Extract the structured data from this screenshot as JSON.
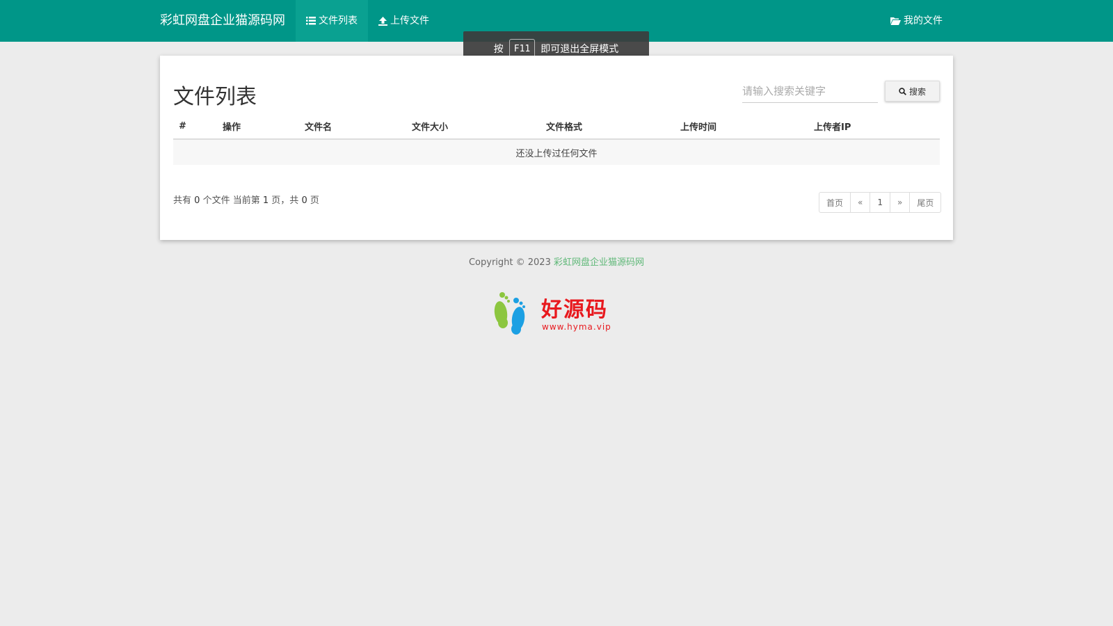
{
  "navbar": {
    "brand": "彩虹网盘企业猫源码网",
    "items": [
      {
        "label": "文件列表",
        "icon": "list-icon"
      },
      {
        "label": "上传文件",
        "icon": "upload-icon"
      }
    ],
    "right_item": {
      "label": "我的文件",
      "icon": "folder-open-icon"
    },
    "color": "#009688"
  },
  "toast": {
    "prefix": "按",
    "key": "F11",
    "suffix": "即可退出全屏模式"
  },
  "main": {
    "title": "文件列表",
    "search": {
      "placeholder": "请输入搜索关键字",
      "button_label": "搜索"
    },
    "table": {
      "columns": [
        "#",
        "操作",
        "文件名",
        "文件大小",
        "文件格式",
        "上传时间",
        "上传者IP"
      ],
      "empty_message": "还没上传过任何文件"
    },
    "summary": {
      "t1": "共有",
      "count": "0",
      "t2": "个文件  当前第",
      "page": "1",
      "t3": "页，共",
      "pages": "0",
      "t4": "页"
    },
    "pagination": {
      "first": "首页",
      "prev": "«",
      "current": "1",
      "next": "»",
      "last": "尾页"
    }
  },
  "footer": {
    "copyright": "Copyright © 2023",
    "site_name": "彩虹网盘企业猫源码网"
  },
  "logo": {
    "text": "好源码",
    "url": "www.hyma.vip"
  }
}
